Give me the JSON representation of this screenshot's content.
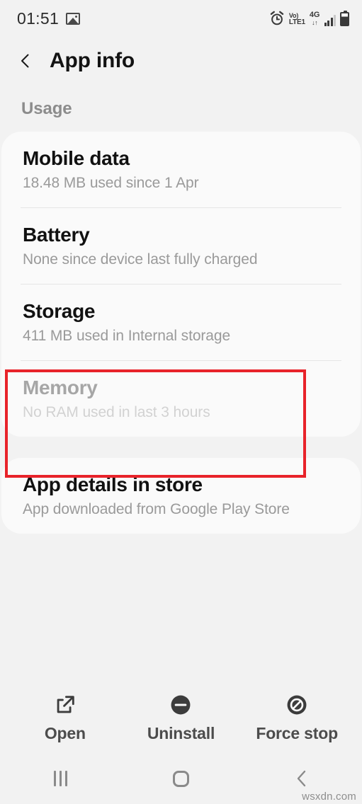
{
  "status_bar": {
    "clock": "01:51",
    "image_icon": "image-icon",
    "alarm_icon": "alarm-icon",
    "volte_top": "Vo)",
    "volte_bottom": "LTE1",
    "network_label": "4G",
    "network_arrows": "↓↑",
    "signal_icon": "signal-bars-icon",
    "battery_icon": "battery-icon"
  },
  "header": {
    "back_icon": "back-chevron-icon",
    "title": "App info"
  },
  "sections": {
    "usage_label": "Usage"
  },
  "usage_items": [
    {
      "title": "Mobile data",
      "subtitle": "18.48 MB used since 1 Apr",
      "disabled": false
    },
    {
      "title": "Battery",
      "subtitle": "None since device last fully charged",
      "disabled": false,
      "highlighted": true
    },
    {
      "title": "Storage",
      "subtitle": "411 MB used in Internal storage",
      "disabled": false
    },
    {
      "title": "Memory",
      "subtitle": "No RAM used in last 3 hours",
      "disabled": true
    }
  ],
  "store_item": {
    "title": "App details in store",
    "subtitle": "App downloaded from Google Play Store"
  },
  "actions": [
    {
      "label": "Open",
      "icon": "open-in-new-icon"
    },
    {
      "label": "Uninstall",
      "icon": "minus-circle-icon"
    },
    {
      "label": "Force stop",
      "icon": "prohibition-circle-icon"
    }
  ],
  "nav_bar": {
    "recents_icon": "recents-icon",
    "home_icon": "home-icon",
    "back_icon": "nav-back-icon"
  },
  "watermark": "wsxdn.com",
  "colors": {
    "highlight": "#e8232a",
    "page_bg": "#f2f2f2",
    "card_bg": "#fafafa",
    "title_text": "#111111",
    "subtitle_text": "#9a9a9a"
  }
}
